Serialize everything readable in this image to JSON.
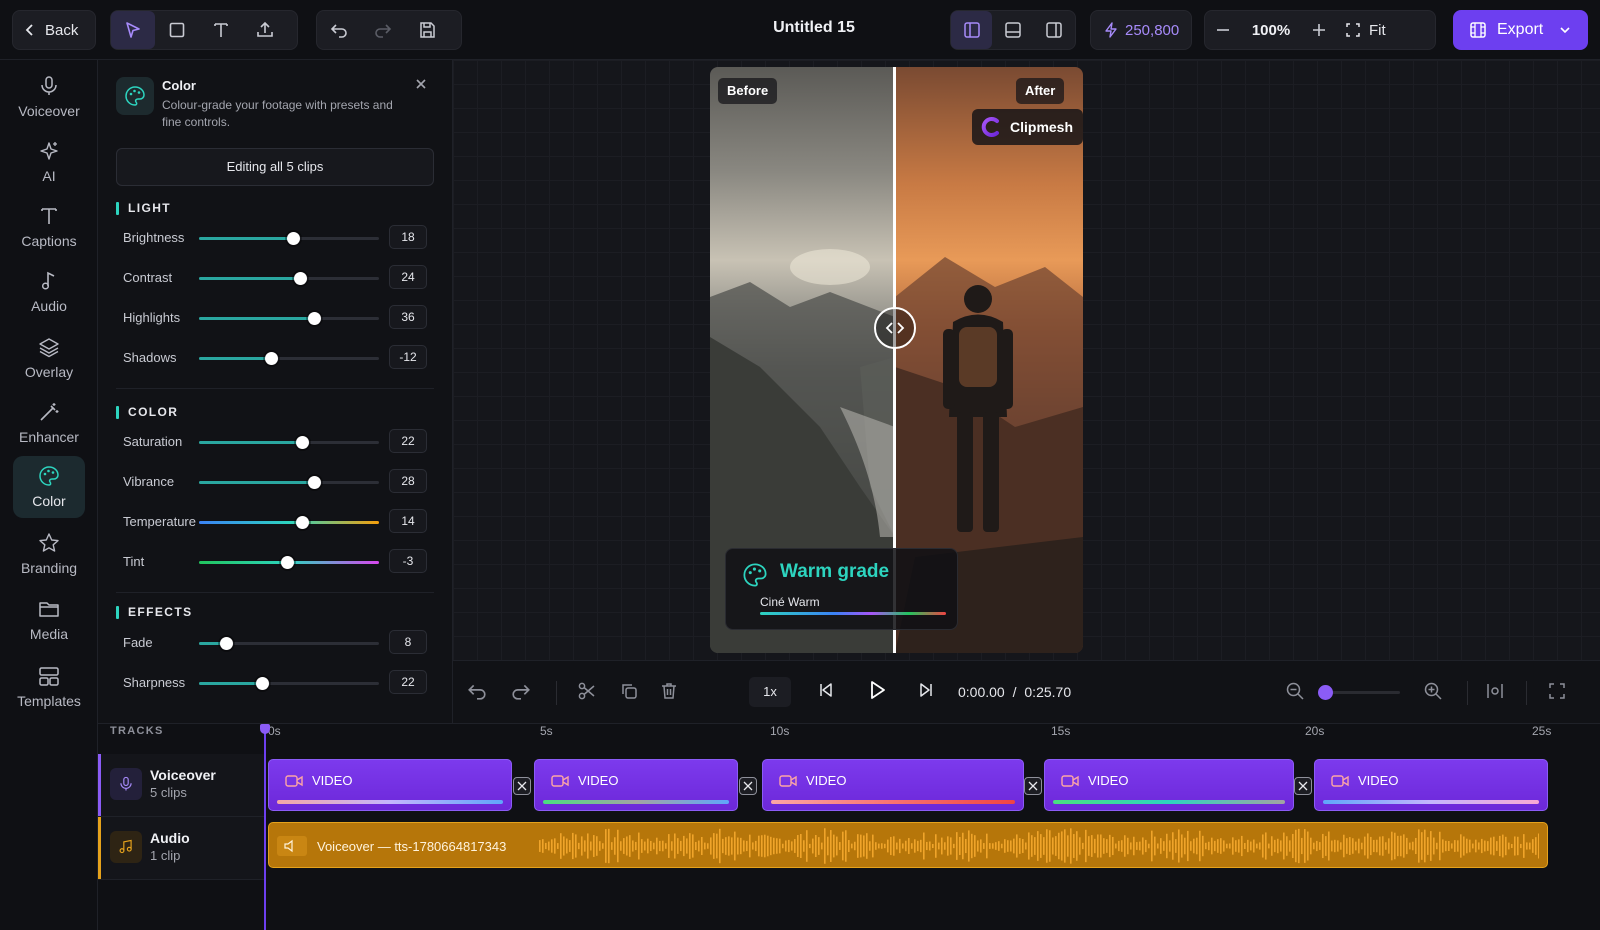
{
  "topbar": {
    "back_label": "Back",
    "title": "Untitled 15",
    "credits": "250,800",
    "zoom": "100%",
    "fit_label": "Fit",
    "export_label": "Export"
  },
  "rail": [
    {
      "label": "Voiceover",
      "icon": "mic-icon"
    },
    {
      "label": "AI",
      "icon": "sparkle-icon"
    },
    {
      "label": "Captions",
      "icon": "text-icon"
    },
    {
      "label": "Audio",
      "icon": "music-note-icon"
    },
    {
      "label": "Overlay",
      "icon": "layers-icon"
    },
    {
      "label": "Enhancer",
      "icon": "magic-wand-icon"
    },
    {
      "label": "Color",
      "icon": "palette-icon",
      "active": true
    },
    {
      "label": "Branding",
      "icon": "star-icon"
    },
    {
      "label": "Media",
      "icon": "folder-icon"
    },
    {
      "label": "Templates",
      "icon": "templates-icon"
    }
  ],
  "panel": {
    "title": "Color",
    "description": "Colour-grade your footage with presets and fine controls.",
    "editing_button": "Editing all 5 clips",
    "sections": [
      {
        "title": "LIGHT",
        "controls": [
          {
            "label": "Brightness",
            "value": "18",
            "position": 0.52
          },
          {
            "label": "Contrast",
            "value": "24",
            "position": 0.56
          },
          {
            "label": "Highlights",
            "value": "36",
            "position": 0.64
          },
          {
            "label": "Shadows",
            "value": "-12",
            "position": 0.4
          }
        ]
      },
      {
        "title": "COLOR",
        "controls": [
          {
            "label": "Saturation",
            "value": "22",
            "position": 0.57
          },
          {
            "label": "Vibrance",
            "value": "28",
            "position": 0.64
          },
          {
            "label": "Temperature",
            "value": "14",
            "position": 0.57
          },
          {
            "label": "Tint",
            "value": "-3",
            "position": 0.49
          }
        ]
      },
      {
        "title": "EFFECTS",
        "controls": [
          {
            "label": "Fade",
            "value": "8",
            "position": 0.15
          },
          {
            "label": "Sharpness",
            "value": "22",
            "position": 0.35
          }
        ]
      }
    ]
  },
  "preview": {
    "before_label": "Before",
    "after_label": "After",
    "brand_label": "Clipmesh",
    "grade_title": "Warm grade",
    "grade_preset": "Ciné Warm"
  },
  "playback": {
    "speed": "1x",
    "current_time": "0:00.00",
    "separator": "/",
    "total_time": "0:25.70",
    "zoom_level": 0.0
  },
  "timeline": {
    "tracks_label": "TRACKS",
    "ruler": [
      "0s",
      "5s",
      "10s",
      "15s",
      "20s",
      "25s"
    ],
    "tracks": [
      {
        "name": "Voiceover",
        "sub": "5 clips"
      },
      {
        "name": "Audio",
        "sub": "1 clip"
      }
    ],
    "clip_label": "VIDEO",
    "audio_clip_label": "Voiceover — tts-1780664817343"
  },
  "colors": {
    "accent_purple": "#6d3ff0",
    "accent_teal": "#2dd4bf",
    "audio_orange": "#b6760a"
  }
}
